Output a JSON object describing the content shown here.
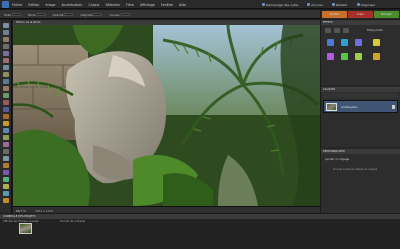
{
  "menubar": {
    "menus": [
      "Fichier",
      "Edition",
      "Image",
      "Accentuation",
      "Calque",
      "Sélection",
      "Filtre",
      "Affichage",
      "Fenêtre",
      "Aide"
    ],
    "right": [
      {
        "icon": "organizer-icon",
        "label": "Démarrage des outils"
      },
      {
        "icon": "light-icon",
        "label": "Annuler"
      },
      {
        "icon": "redo-icon",
        "label": "Rétablir"
      },
      {
        "icon": "organizer-icon",
        "label": "Organiser"
      }
    ]
  },
  "options": [
    "Taille",
    "Mode",
    "Opacité",
    "Dégradé",
    "Couleur"
  ],
  "modes": {
    "edit": "Modifier",
    "create": "Créer",
    "share": "Partager"
  },
  "doc": {
    "tab": "Edition de la photo",
    "zoom": "66,7 %",
    "size": "3264 x 2448"
  },
  "panels": {
    "effects": {
      "title": "EFFETS",
      "filter_label": "Filtres photo"
    },
    "layers": {
      "title": "CALQUES",
      "layer_name": "Arrière-plan"
    },
    "assistant": {
      "title": "PERSONNALISER",
      "hint": "Ajouter un réglage",
      "hint2": "Annuler toutes les étapes de réglage"
    }
  },
  "bin": {
    "title": "CORBEILLE DES PROJETS",
    "show": "Afficher les fichiers ouverts",
    "options": "Format de corbeille"
  }
}
